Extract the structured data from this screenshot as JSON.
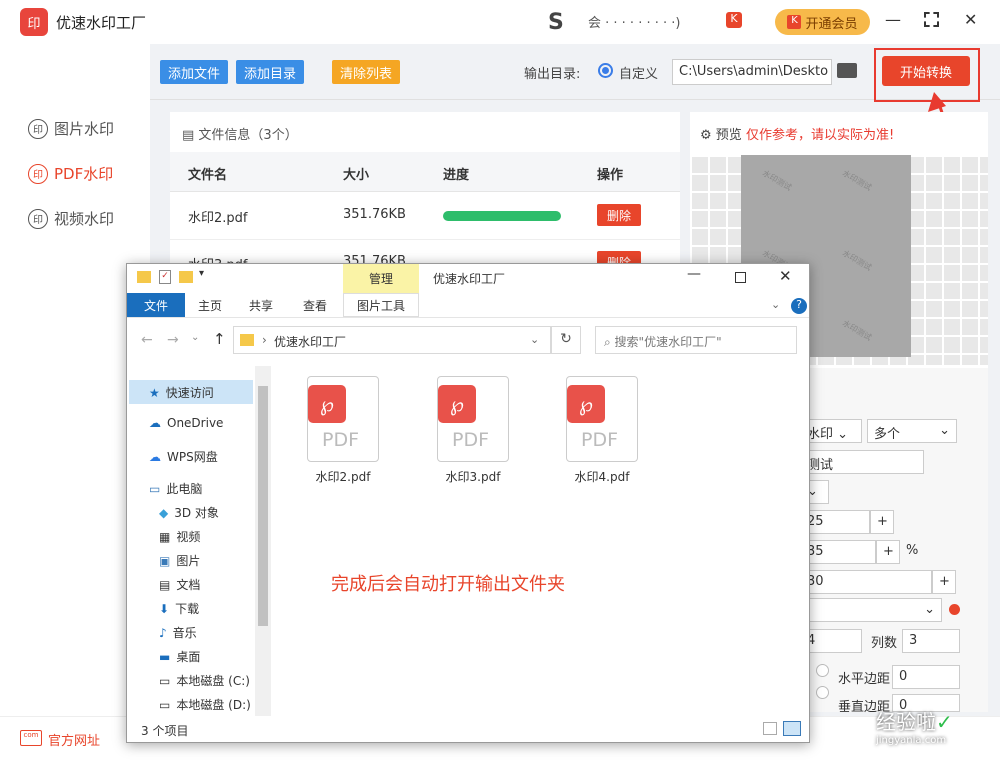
{
  "app": {
    "title": "优速水印工厂",
    "logo_text": "印",
    "user": "会 · · · · · · · · ·)",
    "vip_label": "开通会员"
  },
  "sidebar": {
    "items": [
      {
        "label": "图片水印"
      },
      {
        "label": "PDF水印"
      },
      {
        "label": "视频水印"
      }
    ],
    "footer_link": "官方网址"
  },
  "toolbar": {
    "add_file": "添加文件",
    "add_folder": "添加目录",
    "clear_list": "清除列表",
    "output_label": "输出目录:",
    "custom_label": "自定义",
    "output_path": "C:\\Users\\admin\\Deskto",
    "start_button": "开始转换"
  },
  "file_panel": {
    "header": "文件信息（3个）",
    "columns": [
      "文件名",
      "大小",
      "进度",
      "操作"
    ],
    "rows": [
      {
        "name": "水印2.pdf",
        "size": "351.76KB",
        "progress": 1.0,
        "action": "删除"
      },
      {
        "name": "水印3.pdf",
        "size": "351.76KB",
        "progress": 1.0,
        "action": "删除"
      }
    ]
  },
  "preview": {
    "label": "预览",
    "note": "仅作参考，请以实际为准!",
    "watermark_text": "水印测试"
  },
  "settings": {
    "type_select": "水印",
    "count_select": "多个",
    "text_value": "测试",
    "v1": "25",
    "v2": "35",
    "v2_unit": "%",
    "v3": "30",
    "col_label": "列数",
    "col_value": "3",
    "row_value": "4",
    "h_margin_label": "水平边距",
    "h_margin_value": "0",
    "v_margin_label": "垂直边距",
    "v_margin_value": "0"
  },
  "explorer": {
    "title": "优速水印工厂",
    "manage_tab": "管理",
    "ribbon": {
      "file": "文件",
      "home": "主页",
      "share": "共享",
      "view": "查看",
      "picture_tools": "图片工具"
    },
    "address": "优速水印工厂",
    "search_placeholder": "搜索\"优速水印工厂\"",
    "tree": [
      "快速访问",
      "OneDrive",
      "WPS网盘",
      "此电脑",
      "3D 对象",
      "视频",
      "图片",
      "文档",
      "下载",
      "音乐",
      "桌面",
      "本地磁盘 (C:)",
      "本地磁盘 (D:)"
    ],
    "files": [
      "水印2.pdf",
      "水印3.pdf",
      "水印4.pdf"
    ],
    "pdf_label": "PDF",
    "status": "3 个项目",
    "note": "完成后会自动打开输出文件夹"
  },
  "watermark": {
    "brand": "经验啦",
    "url": "jingyanla.com"
  },
  "colors": {
    "accent_red": "#e8452b",
    "blue_btn": "#3a8ee6",
    "orange_btn": "#f5a623",
    "progress": "#2ebd6b"
  }
}
